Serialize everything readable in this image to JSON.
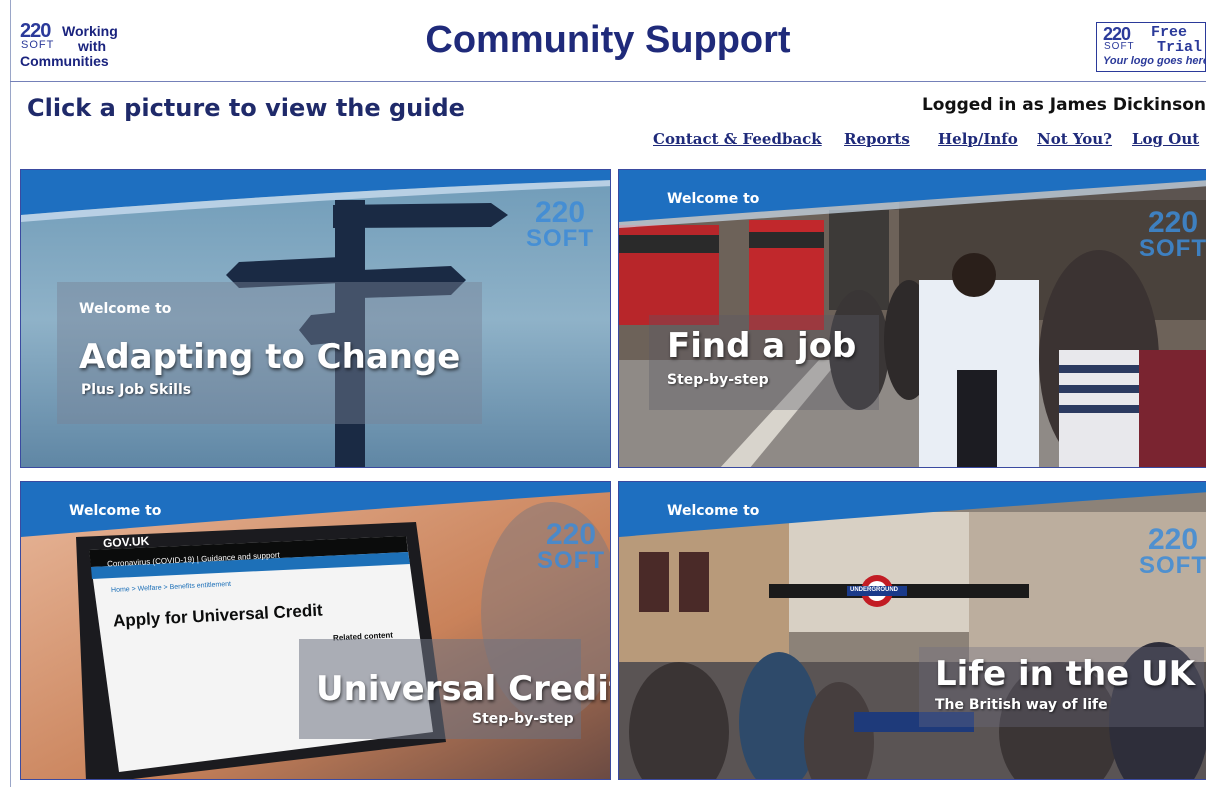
{
  "header": {
    "logo_left": {
      "num": "220",
      "soft": "SOFT",
      "line1": "Working",
      "line2": "with",
      "line3": "Communities"
    },
    "title": "Community Support",
    "logo_right": {
      "num": "220",
      "soft": "SOFT",
      "line1": "Free",
      "line2": "Trial",
      "sub": "Your logo goes here"
    }
  },
  "subheader": {
    "instruction": "Click a picture to view the guide",
    "logged_in": "Logged in as James Dickinson"
  },
  "nav": {
    "contact": "Contact & Feedback",
    "reports": "Reports",
    "help": "Help/Info",
    "not_you": "Not You?",
    "logout": "Log Out"
  },
  "cards": [
    {
      "welcome": "Welcome to",
      "title": "Adapting to Change",
      "subtitle": "Plus Job Skills",
      "brand_num": "220",
      "brand_soft": "SOFT"
    },
    {
      "welcome": "Welcome to",
      "title": "Find a job",
      "subtitle": "Step-by-step",
      "brand_num": "220",
      "brand_soft": "SOFT"
    },
    {
      "welcome": "Welcome to",
      "title": "Universal Credit",
      "subtitle": "Step-by-step",
      "brand_num": "220",
      "brand_soft": "SOFT",
      "screen": {
        "site": "GOV.UK",
        "crumb": "Coronavirus (COVID-19) | Guidance and support",
        "breadcrumb": "Home > Welfare > Benefits entitlement",
        "heading": "Apply for Universal Credit",
        "related": "Related content"
      }
    },
    {
      "welcome": "Welcome to",
      "title": "Life in the UK",
      "subtitle": "The British way of life",
      "brand_num": "220",
      "brand_soft": "SOFT",
      "sign": "UNDERGROUND"
    }
  ],
  "colors": {
    "navy": "#1f2a7a",
    "banner": "#1e6fc0",
    "brand": "#3d8bd8"
  }
}
